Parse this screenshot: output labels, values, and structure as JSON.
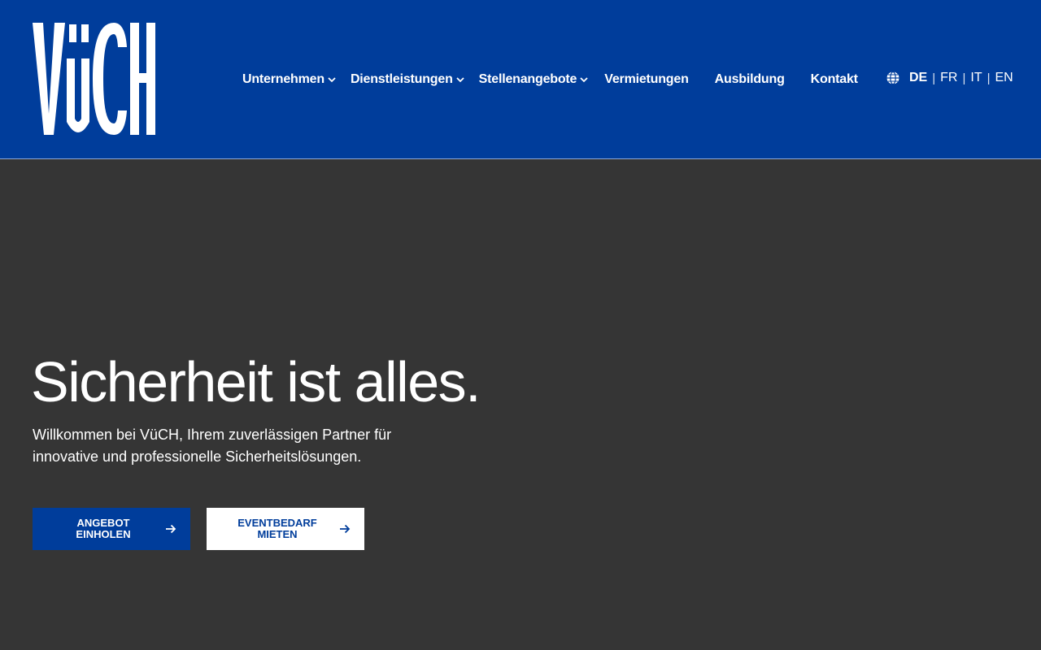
{
  "colors": {
    "brand_blue": "#003d9b",
    "hero_background": "#353535",
    "text_light": "#ffffff"
  },
  "header": {
    "logo_text": "VüCH",
    "nav": [
      {
        "label": "Unternehmen",
        "has_dropdown": true
      },
      {
        "label": "Dienstleistungen",
        "has_dropdown": true
      },
      {
        "label": "Stellenangebote",
        "has_dropdown": true
      },
      {
        "label": "Vermietungen",
        "has_dropdown": false
      },
      {
        "label": "Ausbildung",
        "has_dropdown": false
      },
      {
        "label": "Kontakt",
        "has_dropdown": false
      }
    ],
    "languages": {
      "icon": "globe-icon",
      "items": [
        "DE",
        "FR",
        "IT",
        "EN"
      ],
      "active": "DE"
    }
  },
  "hero": {
    "title": "Sicherheit ist alles.",
    "subtitle": "Willkommen bei VüCH, Ihrem zuverlässigen Partner für innovative und professionelle Sicherheitslösungen.",
    "buttons": [
      {
        "label": "ANGEBOT\nEINHOLEN",
        "icon": "arrow-right-icon",
        "style": "primary"
      },
      {
        "label": "EVENTBEDARF\nMIETEN",
        "icon": "arrow-right-icon",
        "style": "secondary"
      }
    ]
  }
}
